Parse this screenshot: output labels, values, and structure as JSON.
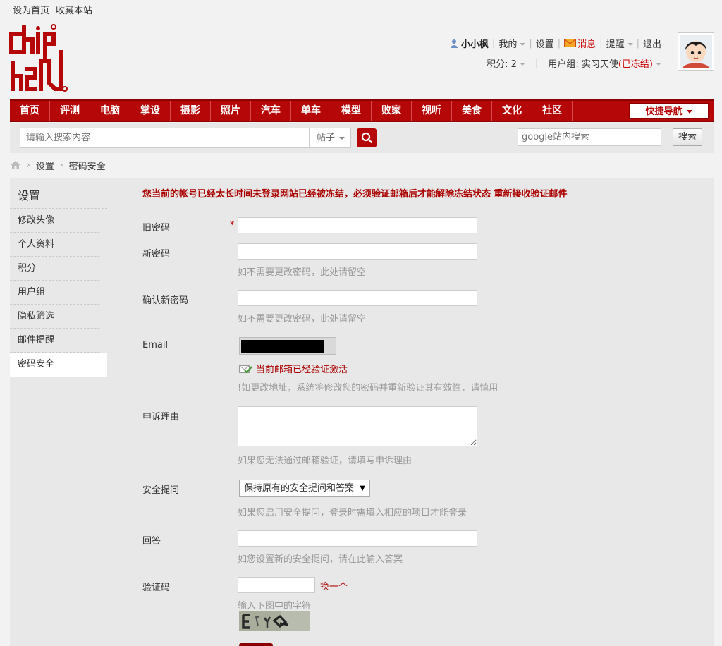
{
  "topbar": {
    "set_home": "设为首页",
    "bookmark": "收藏本站"
  },
  "user": {
    "name": "小小枫",
    "my": "我的",
    "settings": "设置",
    "messages": "消息",
    "reminders": "提醒",
    "logout": "退出",
    "points": "积分: 2",
    "group_label": "用户组: 实习天使",
    "group_status": "(已冻结)"
  },
  "nav": {
    "items": [
      "首页",
      "评测",
      "电脑",
      "掌设",
      "摄影",
      "照片",
      "汽车",
      "单车",
      "模型",
      "败家",
      "视听",
      "美食",
      "文化",
      "社区"
    ],
    "quick_nav": "快捷导航"
  },
  "search": {
    "placeholder": "请输入搜索内容",
    "type": "帖子",
    "google_placeholder": "google站内搜索",
    "google_button": "搜索"
  },
  "breadcrumb": {
    "items": [
      "设置",
      "密码安全"
    ]
  },
  "sidebar": {
    "title": "设置",
    "items": [
      "修改头像",
      "个人资料",
      "积分",
      "用户组",
      "隐私筛选",
      "邮件提醒",
      "密码安全"
    ]
  },
  "form": {
    "notice": "您当前的帐号已经太长时间未登录网站已经被冻结，必须验证邮箱后才能解除冻结状态 重新接收验证邮件",
    "old_password": {
      "label": "旧密码",
      "required": "*"
    },
    "new_password": {
      "label": "新密码",
      "hint": "如不需要更改密码，此处请留空"
    },
    "confirm_password": {
      "label": "确认新密码",
      "hint": "如不需要更改密码，此处请留空"
    },
    "email": {
      "label": "Email",
      "verified": "当前邮箱已经验证激活",
      "hint": "!如更改地址，系统将修改您的密码并重新验证其有效性，请慎用"
    },
    "appeal": {
      "label": "申诉理由",
      "hint": "如果您无法通过邮箱验证，请填写申诉理由"
    },
    "security_question": {
      "label": "安全提问",
      "selected": "保持原有的安全提问和答案",
      "hint": "如果您启用安全提问，登录时需填入相应的项目才能登录"
    },
    "answer": {
      "label": "回答",
      "hint": "如您设置新的安全提问，请在此输入答案"
    },
    "captcha": {
      "label": "验证码",
      "change": "换一个",
      "hint": "输入下图中的字符"
    }
  },
  "colors": {
    "brand": "#b50707",
    "notice": "#aa0000"
  }
}
